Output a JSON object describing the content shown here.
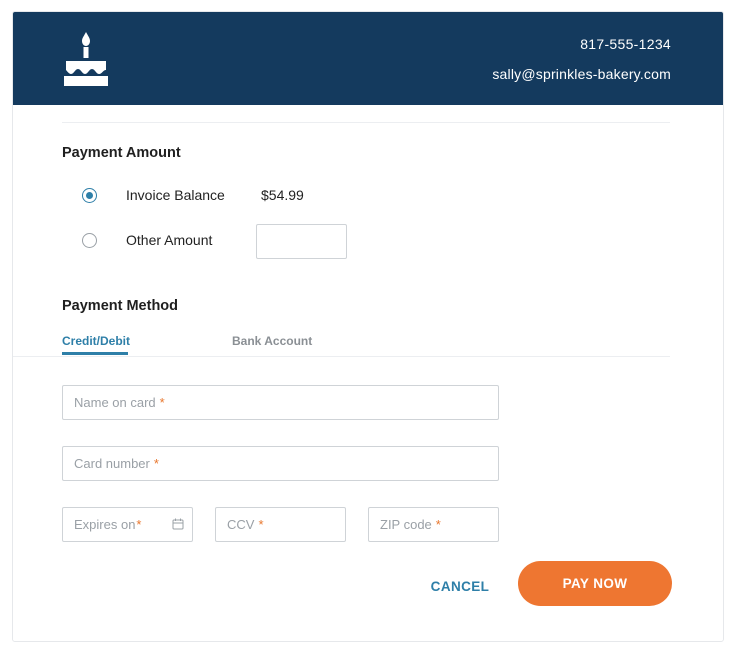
{
  "header": {
    "logo_icon": "birthday-cake-icon",
    "phone": "817-555-1234",
    "email": "sally@sprinkles-bakery.com"
  },
  "payment_amount": {
    "title": "Payment Amount",
    "options": [
      {
        "label": "Invoice Balance",
        "value": "$54.99",
        "selected": true
      },
      {
        "label": "Other Amount",
        "value": "",
        "selected": false
      }
    ]
  },
  "payment_method": {
    "title": "Payment Method",
    "tabs": [
      {
        "label": "Credit/Debit",
        "active": true
      },
      {
        "label": "Bank Account",
        "active": false
      }
    ]
  },
  "form": {
    "name_placeholder": "Name on card",
    "card_placeholder": "Card number",
    "expires_placeholder": "Expires on",
    "ccv_placeholder": "CCV",
    "zip_placeholder": "ZIP code",
    "required_marker": "*"
  },
  "actions": {
    "cancel_label": "CANCEL",
    "pay_label": "PAY NOW"
  },
  "colors": {
    "header_bg": "#143a5e",
    "accent": "#2e7fa8",
    "primary_button": "#ee7631"
  }
}
